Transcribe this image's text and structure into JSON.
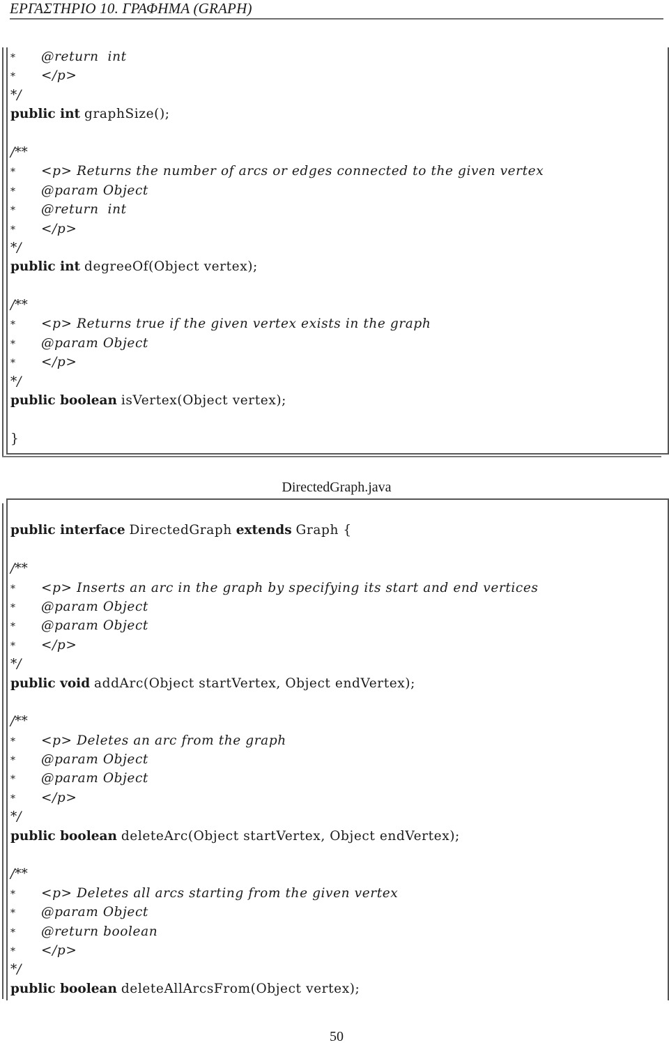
{
  "running_head": "ΕΡΓΑΣΤΗΡΙΟ 10.   ΓΡΑΦΗΜΑ (GRAPH)",
  "box1": {
    "lines": [
      {
        "type": "doc",
        "text": "@return  int"
      },
      {
        "type": "doc",
        "text": "</p>"
      },
      {
        "type": "end",
        "text": "*/"
      },
      {
        "type": "sig",
        "kw": "public int",
        "rest": "graphSize();"
      },
      {
        "type": "blank"
      },
      {
        "type": "start",
        "text": "/**"
      },
      {
        "type": "doc",
        "text": "<p> Returns the number of arcs or edges connected to the given vertex"
      },
      {
        "type": "doc",
        "text": "@param Object"
      },
      {
        "type": "doc",
        "text": "@return  int"
      },
      {
        "type": "doc",
        "text": "</p>"
      },
      {
        "type": "end",
        "text": "*/"
      },
      {
        "type": "sig",
        "kw": "public int",
        "rest": "degreeOf(Object vertex);"
      },
      {
        "type": "blank"
      },
      {
        "type": "start",
        "text": "/**"
      },
      {
        "type": "doc",
        "text": "<p> Returns true if the given vertex exists in the graph"
      },
      {
        "type": "doc",
        "text": "@param Object"
      },
      {
        "type": "doc",
        "text": "</p>"
      },
      {
        "type": "end",
        "text": "*/"
      },
      {
        "type": "sig",
        "kw": "public boolean",
        "rest": "isVertex(Object vertex);"
      },
      {
        "type": "blank"
      },
      {
        "type": "plain",
        "text": "}"
      }
    ]
  },
  "file_caption": "DirectedGraph.java",
  "box2": {
    "lines": [
      {
        "type": "blank"
      },
      {
        "type": "sig3",
        "kw": "public interface",
        "rest": "DirectedGraph",
        "kw2": "extends",
        "rest2": "Graph {"
      },
      {
        "type": "blank"
      },
      {
        "type": "start",
        "text": "/**"
      },
      {
        "type": "doc",
        "text": "<p> Inserts an arc in the graph by specifying its start and end vertices"
      },
      {
        "type": "doc",
        "text": "@param Object"
      },
      {
        "type": "doc",
        "text": "@param Object"
      },
      {
        "type": "doc",
        "text": "</p>"
      },
      {
        "type": "end",
        "text": "*/"
      },
      {
        "type": "sig",
        "kw": "public void",
        "rest": "addArc(Object startVertex, Object endVertex);"
      },
      {
        "type": "blank"
      },
      {
        "type": "start",
        "text": "/**"
      },
      {
        "type": "doc",
        "text": "<p> Deletes an arc from the graph"
      },
      {
        "type": "doc",
        "text": "@param Object"
      },
      {
        "type": "doc",
        "text": "@param Object"
      },
      {
        "type": "doc",
        "text": "</p>"
      },
      {
        "type": "end",
        "text": "*/"
      },
      {
        "type": "sig",
        "kw": "public boolean",
        "rest": "deleteArc(Object startVertex, Object endVertex);"
      },
      {
        "type": "blank"
      },
      {
        "type": "start",
        "text": "/**"
      },
      {
        "type": "doc",
        "text": "<p> Deletes all arcs starting from the given vertex"
      },
      {
        "type": "doc",
        "text": "@param Object"
      },
      {
        "type": "doc",
        "text": "@return boolean"
      },
      {
        "type": "doc",
        "text": "</p>"
      },
      {
        "type": "end",
        "text": "*/"
      },
      {
        "type": "sig",
        "kw": "public boolean",
        "rest": "deleteAllArcsFrom(Object vertex);"
      }
    ]
  },
  "comment_star": "*",
  "page_number": "50"
}
